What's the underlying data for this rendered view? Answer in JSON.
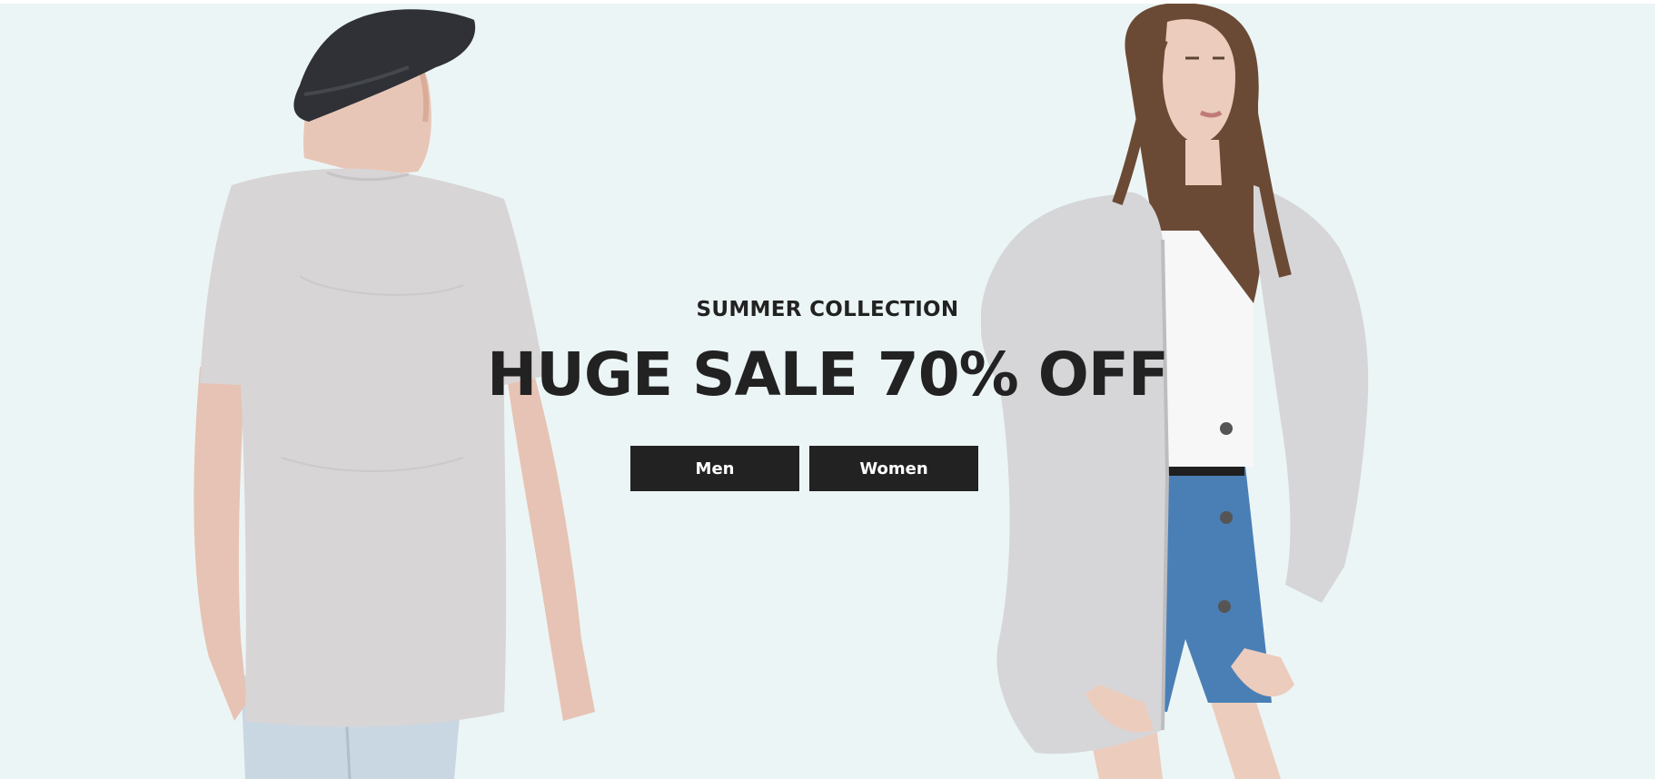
{
  "hero": {
    "subtitle": "SUMMER COLLECTION",
    "headline": "HUGE SALE 70% OFF",
    "buttons": [
      {
        "label": "Men"
      },
      {
        "label": "Women"
      }
    ],
    "colors": {
      "background": "#ecf5f5",
      "text": "#222222",
      "button_bg": "#222222",
      "button_text": "#ffffff"
    }
  }
}
